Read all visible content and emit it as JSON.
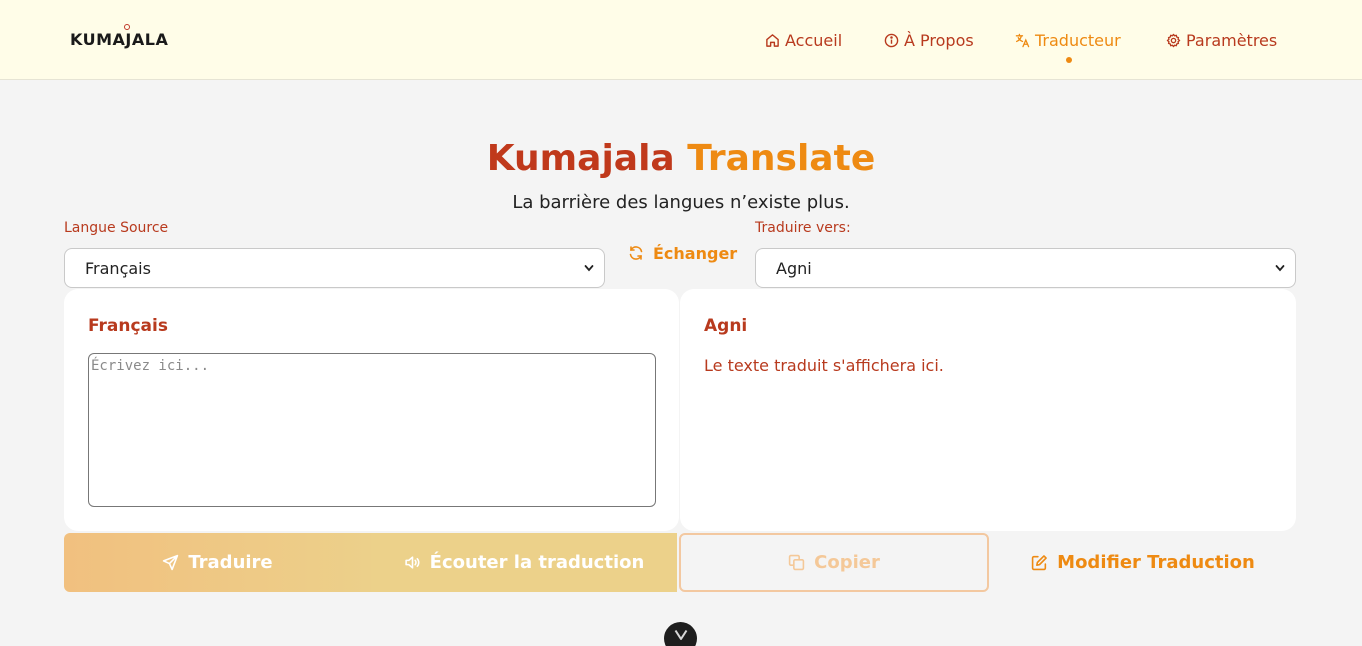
{
  "header": {
    "logo": "KUMAJALA",
    "nav": [
      {
        "label": "Accueil",
        "icon": "home-icon"
      },
      {
        "label": "À Propos",
        "icon": "info-icon"
      },
      {
        "label": "Traducteur",
        "icon": "translate-icon",
        "active": true
      },
      {
        "label": "Paramètres",
        "icon": "gear-icon"
      }
    ]
  },
  "hero": {
    "title_part1": "Kumajala",
    "title_part2": "Translate",
    "subtitle": "La barrière des langues n’existe plus."
  },
  "source": {
    "label": "Langue Source",
    "selected": "Français",
    "card_title": "Français",
    "placeholder": "Écrivez ici..."
  },
  "swap": {
    "label": "Échanger",
    "icon": "swap-icon"
  },
  "target": {
    "label": "Traduire vers:",
    "selected": "Agni",
    "card_title": "Agni",
    "result_placeholder": "Le texte traduit s'affichera ici."
  },
  "actions": {
    "translate": "Traduire",
    "listen": "Écouter la traduction",
    "copy": "Copier",
    "edit": "Modifier Traduction"
  },
  "colors": {
    "brand_red": "#c0391b",
    "brand_orange": "#ee8a12",
    "header_bg": "#fffde8",
    "page_bg": "#f4f4f4"
  }
}
